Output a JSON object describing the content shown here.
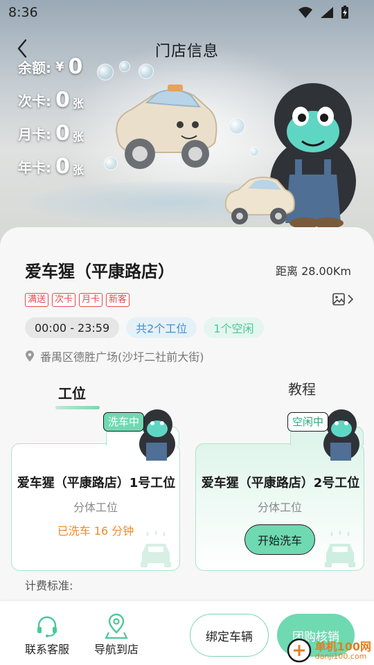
{
  "status_bar": {
    "time": "8:36"
  },
  "header": {
    "title": "门店信息"
  },
  "balances": [
    {
      "label": "余额:",
      "symbol": "¥",
      "value": "0",
      "unit": ""
    },
    {
      "label": "次卡:",
      "symbol": "",
      "value": "0",
      "unit": "张"
    },
    {
      "label": "月卡:",
      "symbol": "",
      "value": "0",
      "unit": "张"
    },
    {
      "label": "年卡:",
      "symbol": "",
      "value": "0",
      "unit": "张"
    }
  ],
  "store": {
    "name": "爱车猩（平康路店）",
    "distance": "距离 28.00Km",
    "tags": [
      "满送",
      "次卡",
      "月卡",
      "新客"
    ],
    "hours": "00:00 - 23:59",
    "total_stations": "共2个工位",
    "free_stations": "1个空闲",
    "address": "番禺区德胜广场(沙圩二社前大街)"
  },
  "tabs": {
    "workstation": "工位",
    "tutorial": "教程"
  },
  "stations": [
    {
      "name": "爱车猩（平康路店）1号工位",
      "type": "分体工位",
      "badge": "洗车中",
      "status": "已洗车 16 分钟"
    },
    {
      "name": "爱车猩（平康路店）2号工位",
      "type": "分体工位",
      "badge": "空闲中",
      "action": "开始洗车"
    }
  ],
  "billing_label": "计费标准:",
  "bottom_bar": {
    "support": "联系客服",
    "navigate": "导航到店",
    "bind_vehicle": "绑定车辆",
    "group_verify": "团购核销"
  },
  "watermark": {
    "main": "单机100网",
    "sub": "danji100.com"
  },
  "colors": {
    "accent": "#6fd9b2",
    "accent_border": "#aee3cd",
    "tag_red": "#e5484d",
    "status_orange": "#f08a2c",
    "blue": "#3b8fd6"
  }
}
